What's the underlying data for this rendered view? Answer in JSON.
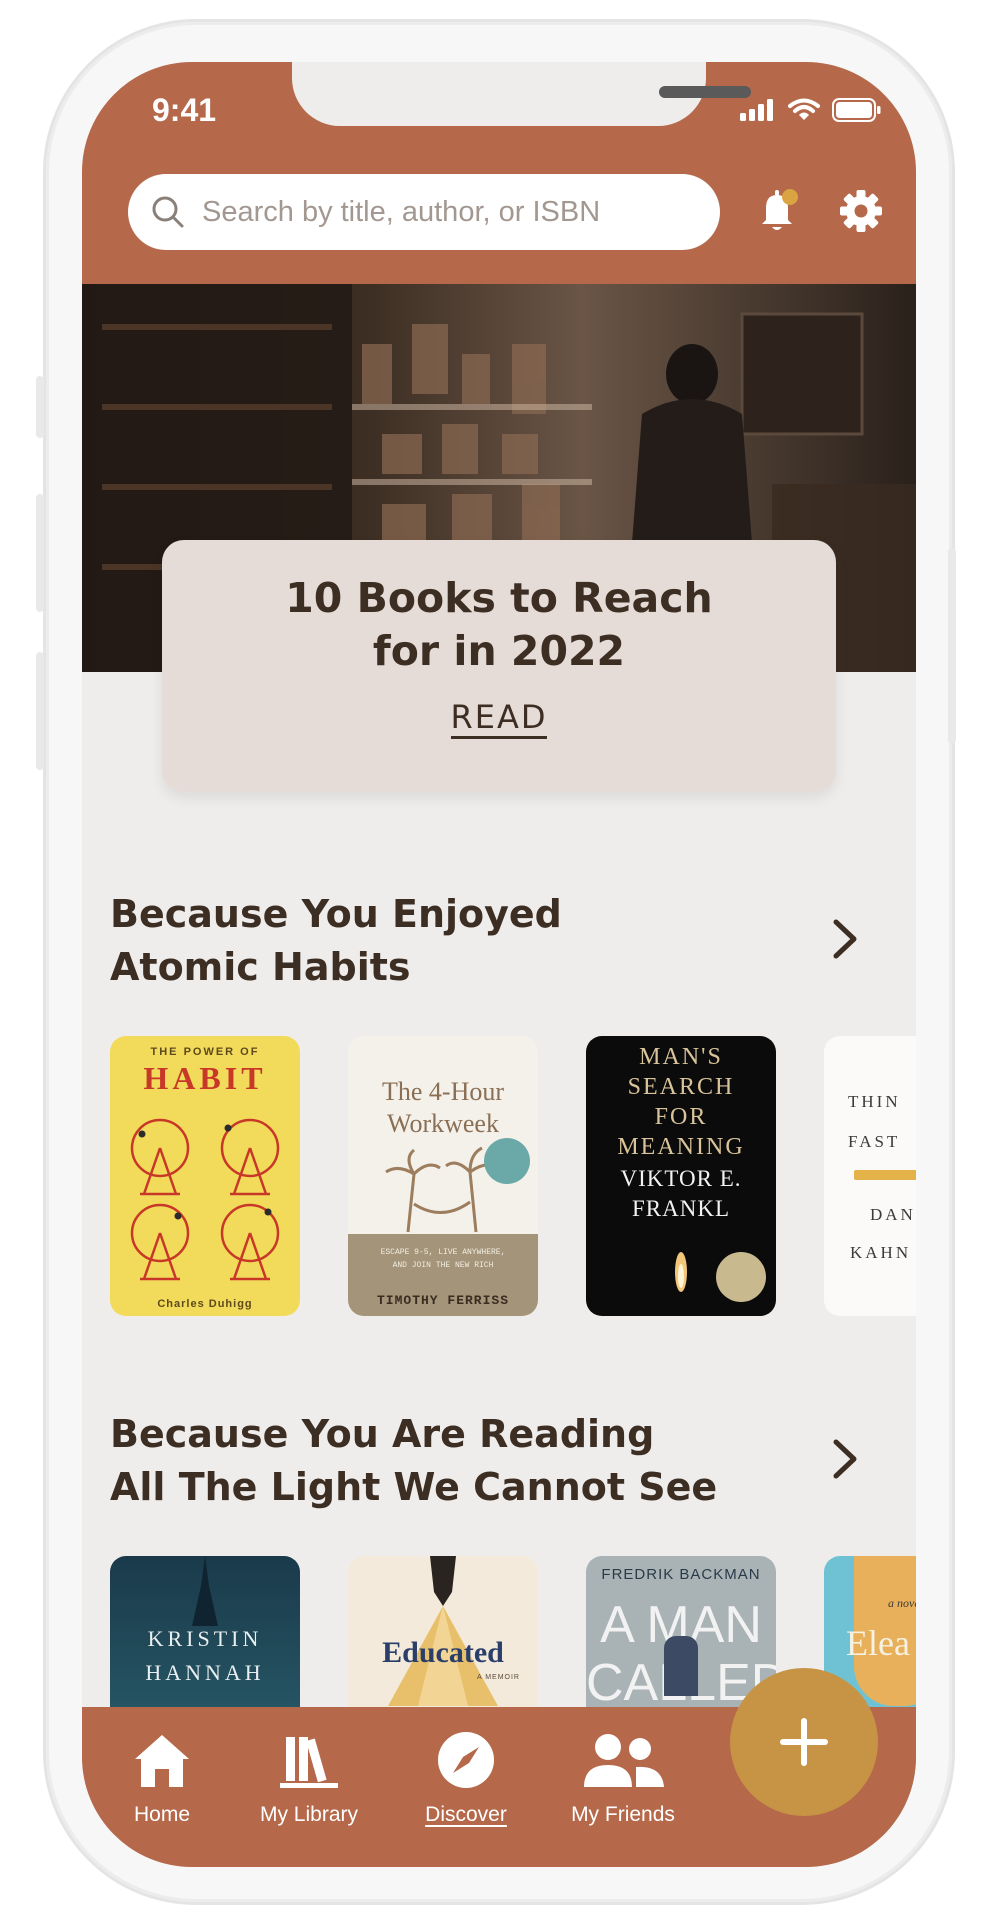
{
  "status_bar": {
    "time": "9:41"
  },
  "search": {
    "placeholder": "Search by title, author, or ISBN"
  },
  "feature": {
    "title_line1": "10 Books to Reach",
    "title_line2": "for in 2022",
    "cta": "READ"
  },
  "sections": [
    {
      "title_line1": "Because You Enjoyed",
      "title_line2": "Atomic Habits",
      "books": [
        {
          "top": "THE POWER OF",
          "title": "HABIT",
          "author": "Charles Duhigg"
        },
        {
          "title_line1": "The 4-Hour",
          "title_line2": "Workweek",
          "tagline_line1": "ESCAPE 9-5, LIVE ANYWHERE,",
          "tagline_line2": "AND JOIN THE NEW RICH",
          "author": "TIMOTHY FERRISS"
        },
        {
          "title_line1": "MAN'S",
          "title_line2": "SEARCH",
          "title_line3": "FOR",
          "title_line4": "MEANING",
          "author_line1": "VIKTOR E.",
          "author_line2": "FRANKL"
        },
        {
          "title_line1": "THIN",
          "title_line2": "FAST",
          "author_line1": "DAN",
          "author_line2": "KAHN"
        }
      ]
    },
    {
      "title_line1": "Because You Are Reading",
      "title_line2": "All The Light We Cannot See",
      "books": [
        {
          "author_line1": "KRISTIN",
          "author_line2": "HANNAH"
        },
        {
          "title": "Educated",
          "subtitle": "A MEMOIR"
        },
        {
          "author": "FREDRIK BACKMAN",
          "title_line1": "A MAN",
          "title_line2": "CALLED"
        },
        {
          "top": "a novel",
          "title": "Elea"
        }
      ]
    }
  ],
  "tabs": [
    {
      "label": "Home"
    },
    {
      "label": "My Library"
    },
    {
      "label": "Discover"
    },
    {
      "label": "My Friends"
    }
  ],
  "colors": {
    "brand": "#b5694a",
    "accent": "#c79345",
    "background": "#efedeb",
    "text": "#3d2e24",
    "notification_dot": "#d9a441"
  },
  "icons": [
    "search-icon",
    "bell-icon",
    "gear-icon",
    "chevron-right-icon",
    "home-icon",
    "library-icon",
    "compass-icon",
    "friends-icon",
    "plus-icon"
  ]
}
